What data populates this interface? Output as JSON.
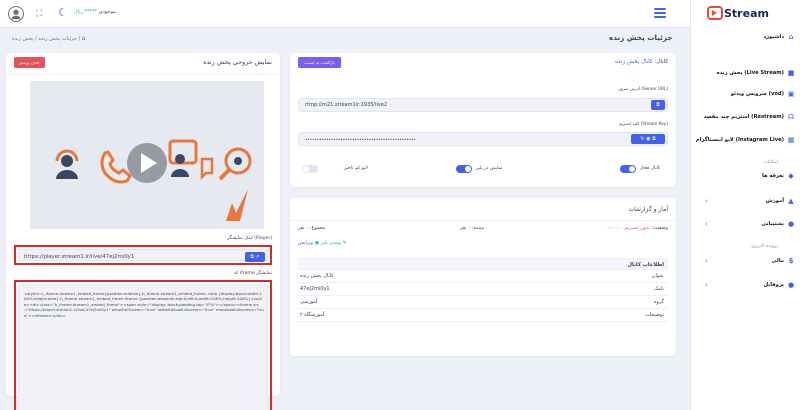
{
  "topbar": {
    "balance_label": "موجودی",
    "balance_value": "***** ریال",
    "avatar": "user-circle-icon",
    "fullscreen": "fullscreen-icon",
    "theme": "moon-icon",
    "menu": "hamburger-icon"
  },
  "sidebar": {
    "logo_text": "Stream",
    "items": [
      {
        "label": "داشبورد",
        "icon": "home-icon"
      },
      {
        "label": "پخش زنده (Live Stream)",
        "icon": "video-icon"
      },
      {
        "label": "سرویس ویدئو (vod)",
        "icon": "folder-video-icon"
      },
      {
        "label": "استریم چند مقصد (Restream)",
        "icon": "headset-icon"
      },
      {
        "label": "لایو اینستاگرام (Instagram Live)",
        "icon": "calendar-icon"
      },
      {
        "label": "تعرفه ها",
        "icon": "tag-icon"
      },
      {
        "label": "آموزش",
        "icon": "graduation-icon"
      },
      {
        "label": "پشتیبانی",
        "icon": "support-icon"
      },
      {
        "label": "مالی",
        "icon": "dollar-icon"
      },
      {
        "label": "پروفایل",
        "icon": "user-icon"
      }
    ],
    "sections": [
      "امکانات",
      "پرونده کاربری"
    ]
  },
  "breadcrumb": {
    "home_icon": "home-icon",
    "items": [
      "پخش زنده",
      "جزئیات پخش زنده"
    ],
    "separator": "/"
  },
  "page_title": "جزئیات پخش زنده",
  "details": {
    "back_button": "بازگشت به لیست",
    "channel_label": "کانال:",
    "channel_value": "کانال پخش زنده",
    "server_label": "آدرس سرور (Server URL)",
    "server_value": "rtmp://m21.stream1ir:1935/live2",
    "key_label": "کلید استریم (Stream Key)",
    "key_value": "•••••••••••••••••••••••••••••••••••••••••••••••",
    "toggles": [
      {
        "label": "کانال فعال",
        "on": true
      },
      {
        "label": "نمایش در پلیر",
        "on": true
      },
      {
        "label": "لایو کم تاخیر",
        "on": false
      }
    ]
  },
  "stats": {
    "title": "آمار و گزارشات",
    "status_label": "وضعیت:",
    "status_value": "بدون استریم",
    "status_time": "۰۰:۰۰:۰۰",
    "viewers": "بیننده: ۰ نفر",
    "total": "مجموع: ۰ نفر",
    "edit_link": "ویرایش",
    "player_link": "پوستر پلیر",
    "info_header": "اطلاعات کانال",
    "rows": [
      {
        "k": "عنوان",
        "v": "کانال پخش زنده"
      },
      {
        "k": "نامک",
        "v": "47ej2mi0y1"
      },
      {
        "k": "گروه",
        "v": "آموزشی"
      },
      {
        "k": "توضیحات",
        "v": "آموزشگاه ۲"
      }
    ]
  },
  "output": {
    "title": "نمایش خروجی پخش زنده",
    "delete_button": "حذف پوستر",
    "player_link_label": "لینک نمایشگر (Player)",
    "player_link_value": "https://player.stream1.ir/live/47ej2mi0y1",
    "iframe_label": "کد iframe نمایشگر",
    "iframe_code": "<style>.h_iframe-stream1_embed_frame{position:relative}.h_iframe-stream1_embed_frame .ratio {display:block;width:100%;height:auto}.h_iframe-stream1_embed_frame iframe {position:absolute;top:0;left:0;width:100%;height:100%}</style><div class=\"h_iframe-stream1_embed_frame\"><span style=\"display: block;padding-top: 57%\"></span><iframe src=\"https://player.stream1.ir/live/47ej2mi0y1\" allowFullScreen=\"true\" webkitallowfullscreen=\"true\" mozallowfullscreen=\"true\"></iframe></div>"
  },
  "colors": {
    "accent": "#4361ee",
    "purple": "#7c5cf2",
    "danger": "#e7515a",
    "success": "#1abc9c",
    "highlight": "#d42b2b"
  }
}
